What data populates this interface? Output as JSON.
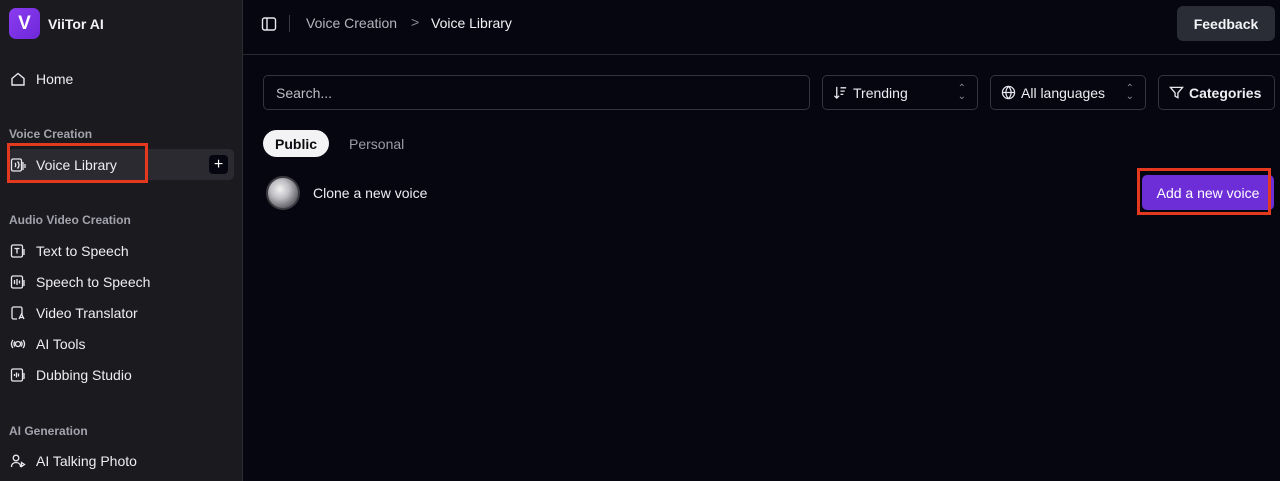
{
  "app": {
    "name": "ViiTor AI",
    "logo_letter": "V",
    "accent": "#6d2ed8"
  },
  "sidebar": {
    "home": "Home",
    "sections": [
      {
        "label": "Voice Creation"
      },
      {
        "label": "Audio Video Creation"
      },
      {
        "label": "AI Generation"
      }
    ],
    "voice_creation_items": [
      {
        "label": "Voice Library",
        "icon": "voice-library-icon",
        "active": true
      }
    ],
    "audio_video_items": [
      {
        "label": "Text to Speech",
        "icon": "text-to-speech-icon"
      },
      {
        "label": "Speech to Speech",
        "icon": "speech-to-speech-icon"
      },
      {
        "label": "Video Translator",
        "icon": "video-translator-icon"
      },
      {
        "label": "AI Tools",
        "icon": "ai-tools-icon"
      },
      {
        "label": "Dubbing Studio",
        "icon": "dubbing-studio-icon"
      }
    ],
    "ai_generation_items": [
      {
        "label": "AI Talking Photo",
        "icon": "talking-photo-icon"
      }
    ]
  },
  "header": {
    "breadcrumb": [
      "Voice Creation",
      "Voice Library"
    ],
    "separator": ">",
    "feedback": "Feedback"
  },
  "filters": {
    "search_placeholder": "Search...",
    "sort": "Trending",
    "language": "All languages",
    "categories": "Categories"
  },
  "tabs": [
    "Public",
    "Personal"
  ],
  "clone": {
    "label": "Clone a new voice",
    "button": "Add a new voice"
  }
}
